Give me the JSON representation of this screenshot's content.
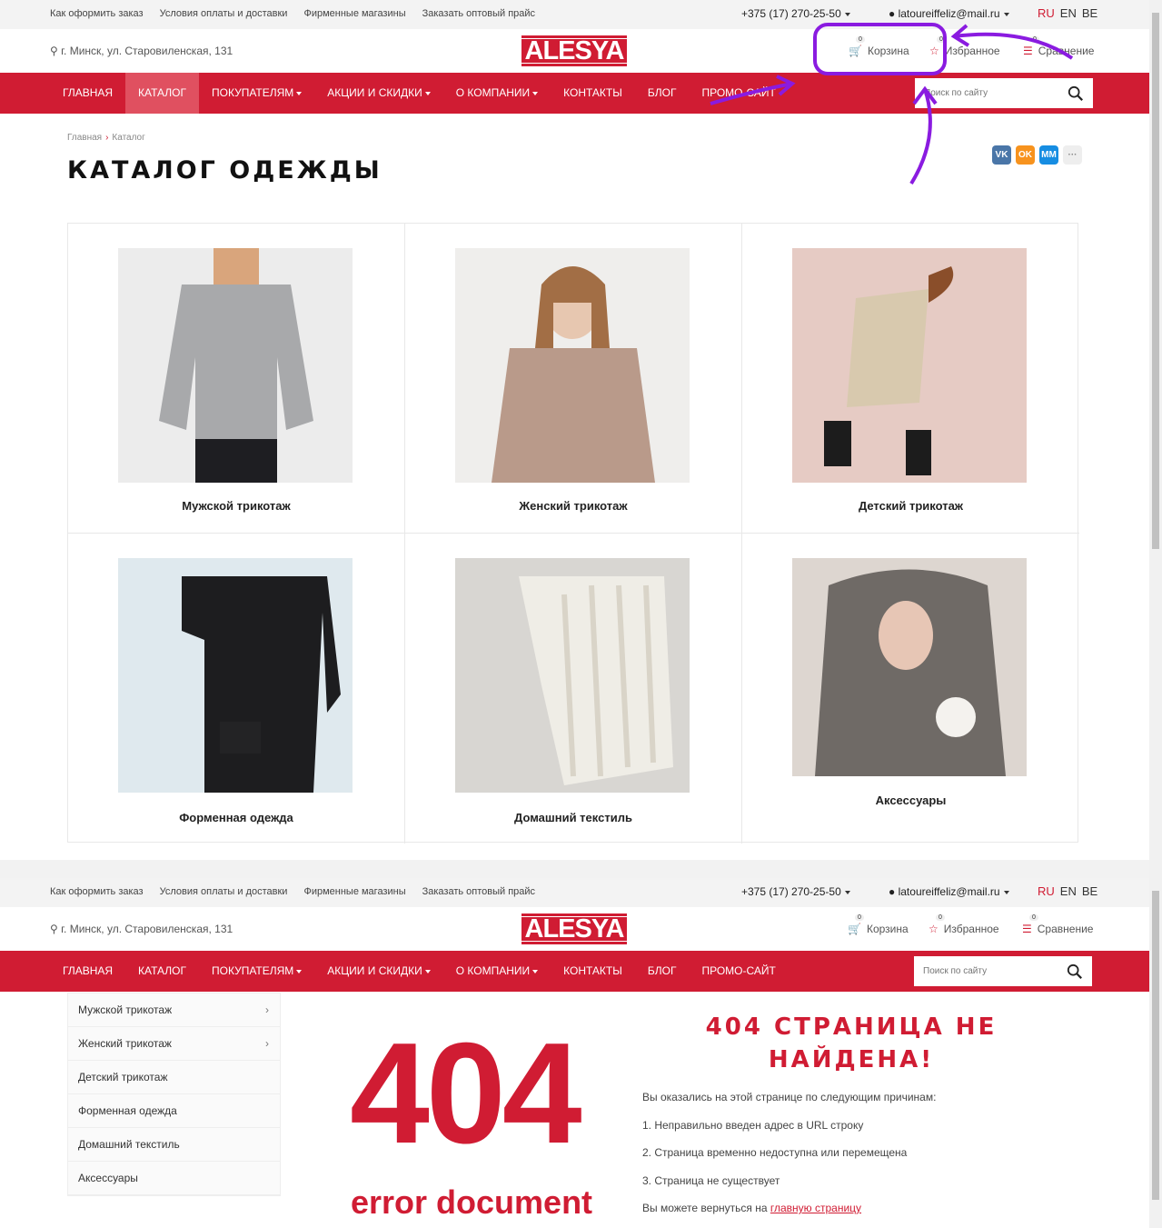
{
  "top_links": [
    "Как оформить заказ",
    "Условия оплаты и доставки",
    "Фирменные магазины",
    "Заказать оптовый прайс"
  ],
  "phone": "+375 (17) 270-25-50",
  "email": "latoureiffeliz@mail.ru",
  "languages": [
    "RU",
    "EN",
    "BE"
  ],
  "address": "г. Минск, ул. Старовиленская, 131",
  "logo_text": "ALESYA",
  "header_icons": {
    "cart": {
      "label": "Корзина",
      "count": "0"
    },
    "favorites": {
      "label": "Избранное",
      "count": "0"
    },
    "compare": {
      "label": "Сравнение",
      "count": "0"
    }
  },
  "nav": [
    "ГЛАВНАЯ",
    "КАТАЛОГ",
    "ПОКУПАТЕЛЯМ",
    "АКЦИИ И СКИДКИ",
    "О КОМПАНИИ",
    "КОНТАКТЫ",
    "БЛОГ",
    "ПРОМО-САЙТ"
  ],
  "search_placeholder": "Поиск по сайту",
  "breadcrumb": [
    "Главная",
    "Каталог"
  ],
  "page_title": "КАТАЛОГ ОДЕЖДЫ",
  "social": [
    "VK",
    "OK",
    "MM",
    "···"
  ],
  "catalog": [
    "Мужской трикотаж",
    "Женский трикотаж",
    "Детский трикотаж",
    "Форменная одежда",
    "Домашний текстиль",
    "Аксессуары"
  ],
  "sidebar": [
    "Мужской трикотаж",
    "Женский трикотаж",
    "Детский трикотаж",
    "Форменная одежда",
    "Домашний текстиль",
    "Аксессуары"
  ],
  "error": {
    "code": "404",
    "subtitle": "error document",
    "title_line1": "404 СТРАНИЦА НЕ",
    "title_line2": "НАЙДЕНА!",
    "intro": "Вы оказались на этой странице по следующим причинам:",
    "reasons": [
      "1. Неправильно введен адрес в URL строку",
      "2. Страница временно недоступна или перемещена",
      "3. Страница не существует"
    ],
    "back_prefix": "Вы можете вернуться на ",
    "back_link": "главную страницу"
  },
  "colors": {
    "brand": "#d01c33",
    "annotation": "#8a1be0"
  }
}
